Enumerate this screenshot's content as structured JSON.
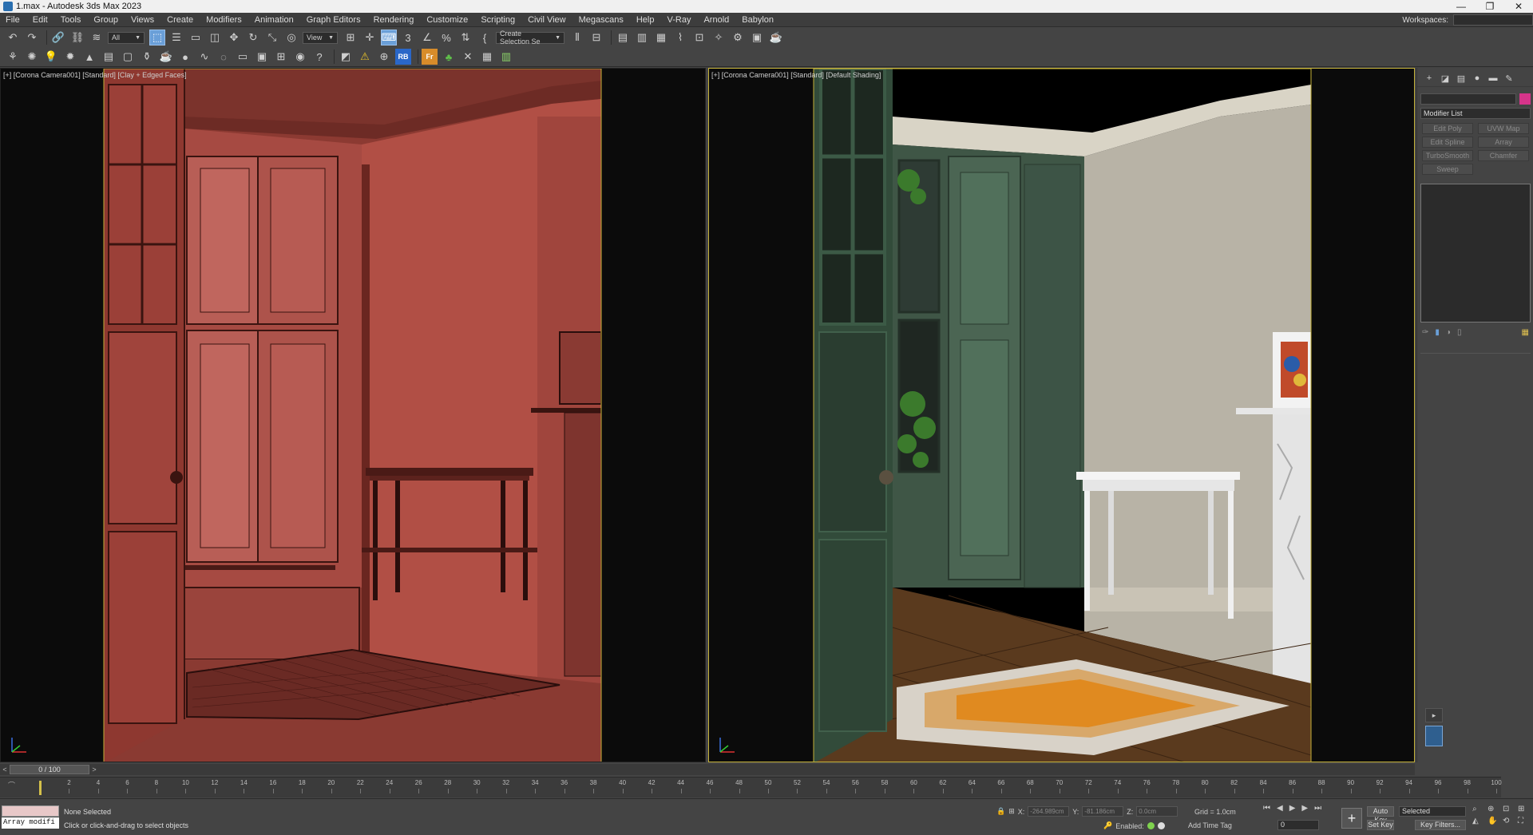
{
  "window": {
    "title": "1.max - Autodesk 3ds Max 2023",
    "controls": [
      "—",
      "❐",
      "✕"
    ]
  },
  "menu": {
    "items": [
      "File",
      "Edit",
      "Tools",
      "Group",
      "Views",
      "Create",
      "Modifiers",
      "Animation",
      "Graph Editors",
      "Rendering",
      "Customize",
      "Scripting",
      "Civil View",
      "Megascans",
      "Help",
      "V-Ray",
      "Arnold",
      "Babylon"
    ],
    "workspaces_label": "Workspaces:"
  },
  "toolbar": {
    "filter_value": "All",
    "refcoord_value": "View",
    "selection_set_value": "Create Selection Se",
    "rb_label": "RB",
    "fr_label": "Fr"
  },
  "viewports": {
    "left": {
      "label": "[+] [Corona Camera001] [Standard] [Clay + Edged Faces]"
    },
    "right": {
      "label": "[+] [Corona Camera001] [Standard] [Default Shading]"
    }
  },
  "command_panel": {
    "modifier_list": "Modifier List",
    "modifier_buttons": [
      "Edit Poly",
      "UVW Map",
      "Edit Spline",
      "Array",
      "TurboSmooth",
      "Chamfer",
      "Sweep"
    ],
    "accent_color": "#d6348a"
  },
  "timeline": {
    "slider_label": "0 / 100",
    "ticks": [
      "2",
      "4",
      "6",
      "8",
      "10",
      "12",
      "14",
      "16",
      "18",
      "20",
      "22",
      "24",
      "26",
      "28",
      "30",
      "32",
      "34",
      "36",
      "38",
      "40",
      "42",
      "44",
      "46",
      "48",
      "50",
      "52",
      "54",
      "56",
      "58",
      "60",
      "62",
      "64",
      "66",
      "68",
      "70",
      "72",
      "74",
      "76",
      "78",
      "80",
      "82",
      "84",
      "86",
      "88",
      "90",
      "92",
      "94",
      "96",
      "98",
      "100"
    ],
    "current_frame": 0
  },
  "status": {
    "maxscript_text": "Array modifi",
    "selection_text": "None Selected",
    "prompt_text": "Click or click-and-drag to select objects",
    "x_label": "X:",
    "x_value": "-264.989cm",
    "y_label": "Y:",
    "y_value": "-81.186cm",
    "z_label": "Z:",
    "z_value": "0.0cm",
    "grid_text": "Grid = 1.0cm",
    "enabled_label": "Enabled:",
    "add_time_tag": "Add Time Tag",
    "frame_value": "0",
    "auto_key": "Auto Key",
    "set_key": "Set Key",
    "selected_dropdown": "Selected",
    "key_filters": "Key Filters..."
  }
}
